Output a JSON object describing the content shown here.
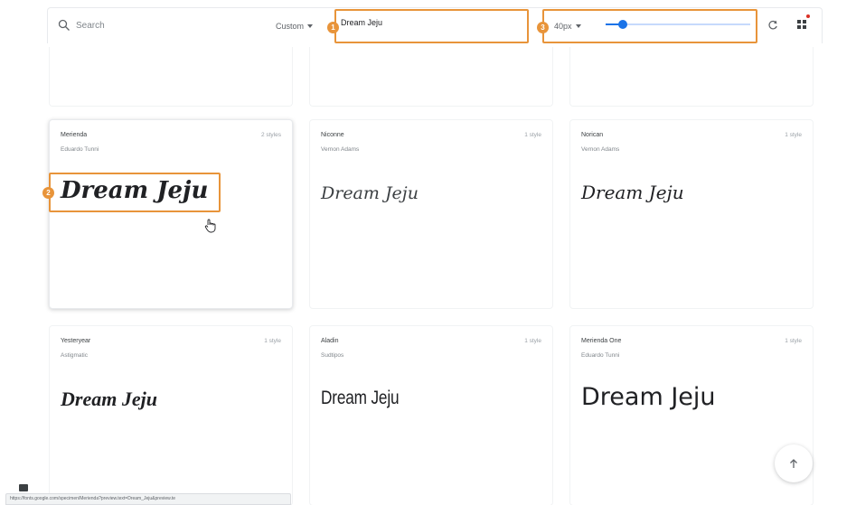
{
  "toolbar": {
    "search_placeholder": "Search",
    "category_label": "Custom",
    "preview_text": "Dream Jeju",
    "size_label": "40px",
    "size_slider_fraction": 0.12
  },
  "callouts": [
    "1",
    "2",
    "3"
  ],
  "cards": [
    {
      "name": "Merienda",
      "author": "Eduardo Tunni",
      "styles": "2 styles",
      "sample": "Dream Jeju"
    },
    {
      "name": "Niconne",
      "author": "Vernon Adams",
      "styles": "1 style",
      "sample": "Dream Jeju"
    },
    {
      "name": "Norican",
      "author": "Vernon Adams",
      "styles": "1 style",
      "sample": "Dream Jeju"
    },
    {
      "name": "Yesteryear",
      "author": "Astigmatic",
      "styles": "1 style",
      "sample": "Dream Jeju"
    },
    {
      "name": "Aladin",
      "author": "Sudtipos",
      "styles": "1 style",
      "sample": "Dream Jeju"
    },
    {
      "name": "Merienda One",
      "author": "Eduardo Tunni",
      "styles": "1 style",
      "sample": "Dream Jeju"
    }
  ],
  "status_url": "https://fonts.google.com/specimen/Merienda?preview.text=Dream_Jeju&preview.te",
  "colors": {
    "accent": "#1a73e8",
    "highlight": "#e8943a"
  }
}
